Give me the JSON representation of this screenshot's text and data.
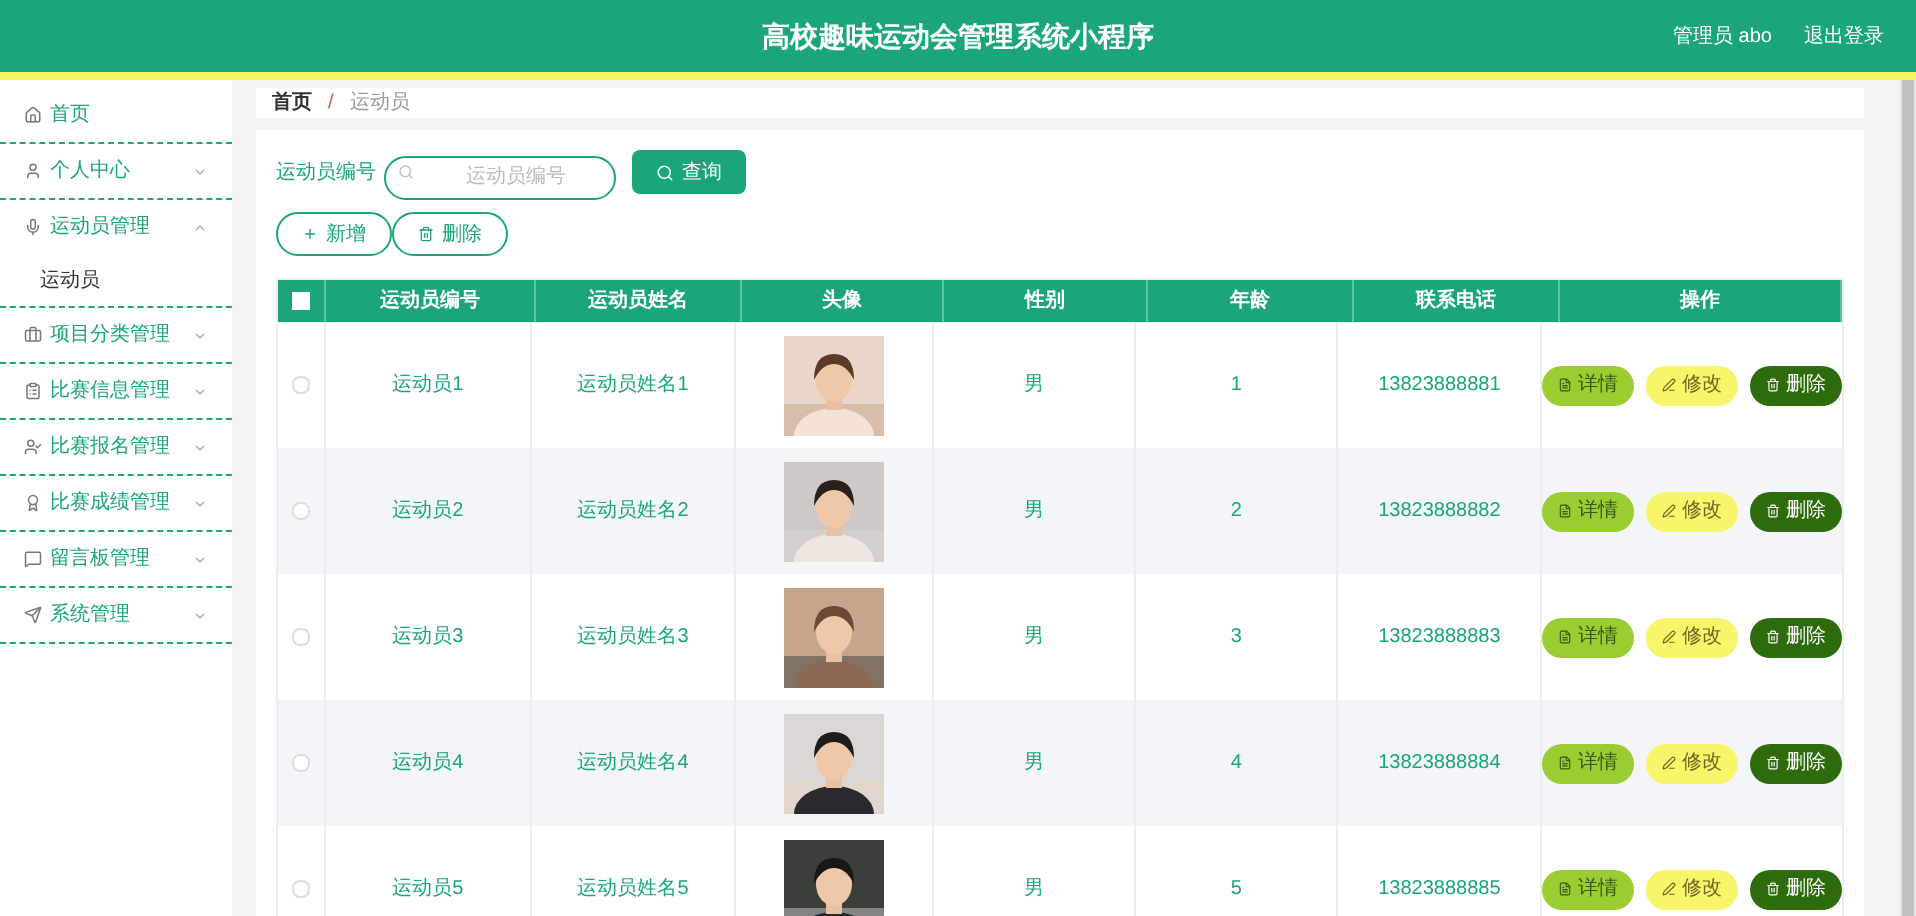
{
  "header": {
    "title": "高校趣味运动会管理系统小程序",
    "user": "管理员 abo",
    "logout": "退出登录"
  },
  "sidebar": [
    {
      "label": "首页"
    },
    {
      "label": "个人中心",
      "expanded": false
    },
    {
      "label": "运动员管理",
      "expanded": true,
      "children": [
        {
          "label": "运动员"
        }
      ]
    },
    {
      "label": "项目分类管理",
      "expanded": false
    },
    {
      "label": "比赛信息管理",
      "expanded": false
    },
    {
      "label": "比赛报名管理",
      "expanded": false
    },
    {
      "label": "比赛成绩管理",
      "expanded": false
    },
    {
      "label": "留言板管理",
      "expanded": false
    },
    {
      "label": "系统管理",
      "expanded": false
    }
  ],
  "breadcrumb": {
    "separator": "/",
    "items": [
      "首页",
      "运动员"
    ]
  },
  "search": {
    "label": "运动员编号",
    "placeholder": "运动员编号",
    "button": "查询"
  },
  "toolbar": [
    {
      "kind": "add",
      "label": "新增"
    },
    {
      "kind": "delete",
      "label": "删除"
    }
  ],
  "table": {
    "select_all": {
      "checked": false
    },
    "columns": [
      "运动员编号",
      "运动员姓名",
      "头像",
      "性别",
      "年龄",
      "联系电话",
      "操作"
    ],
    "rows": [
      {
        "selected": false,
        "cells": [
          "运动员1",
          "运动员姓名1",
          {
            "kind": "picture"
          },
          "男",
          "1",
          "13823888881"
        ],
        "actions": [
          {
            "kind": "detail",
            "label": "详情"
          },
          {
            "kind": "edit",
            "label": "修改"
          },
          {
            "kind": "delete",
            "label": "删除"
          }
        ]
      },
      {
        "selected": false,
        "cells": [
          "运动员2",
          "运动员姓名2",
          {
            "kind": "picture"
          },
          "男",
          "2",
          "13823888882"
        ],
        "actions": [
          {
            "kind": "detail",
            "label": "详情"
          },
          {
            "kind": "edit",
            "label": "修改"
          },
          {
            "kind": "delete",
            "label": "删除"
          }
        ]
      },
      {
        "selected": false,
        "cells": [
          "运动员3",
          "运动员姓名3",
          {
            "kind": "picture"
          },
          "男",
          "3",
          "13823888883"
        ],
        "actions": [
          {
            "kind": "detail",
            "label": "详情"
          },
          {
            "kind": "edit",
            "label": "修改"
          },
          {
            "kind": "delete",
            "label": "删除"
          }
        ]
      },
      {
        "selected": false,
        "cells": [
          "运动员4",
          "运动员姓名4",
          {
            "kind": "picture"
          },
          "男",
          "4",
          "13823888884"
        ],
        "actions": [
          {
            "kind": "detail",
            "label": "详情"
          },
          {
            "kind": "edit",
            "label": "修改"
          },
          {
            "kind": "delete",
            "label": "删除"
          }
        ]
      },
      {
        "selected": false,
        "cells": [
          "运动员5",
          "运动员姓名5",
          {
            "kind": "picture"
          },
          "男",
          "5",
          "13823888885"
        ],
        "actions": [
          {
            "kind": "detail",
            "label": "详情"
          },
          {
            "kind": "edit",
            "label": "修改"
          },
          {
            "kind": "delete",
            "label": "删除"
          }
        ]
      }
    ]
  }
}
